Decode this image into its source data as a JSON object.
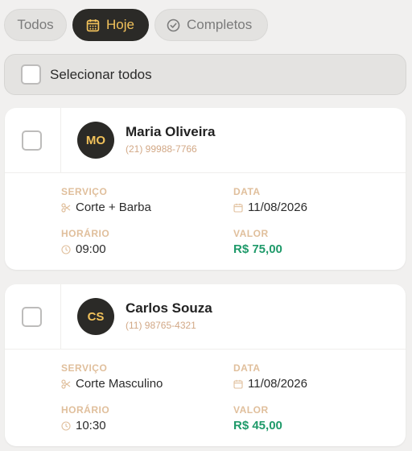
{
  "tabs": [
    {
      "label": "Todos",
      "active": false
    },
    {
      "label": "Hoje",
      "active": true,
      "icon": "calendar-icon"
    },
    {
      "label": "Completos",
      "active": false,
      "icon": "check-circle-icon"
    }
  ],
  "select_all": {
    "label": "Selecionar todos",
    "checked": false
  },
  "field_labels": {
    "service": "SERVIÇO",
    "date": "DATA",
    "time": "HORÁRIO",
    "value": "VALOR"
  },
  "appointments": [
    {
      "initials": "MO",
      "name": "Maria Oliveira",
      "phone": "(21) 99988-7766",
      "service": "Corte + Barba",
      "date": "11/08/2026",
      "time": "09:00",
      "value": "R$ 75,00",
      "checked": false
    },
    {
      "initials": "CS",
      "name": "Carlos Souza",
      "phone": "(11) 98765-4321",
      "service": "Corte Masculino",
      "date": "11/08/2026",
      "time": "10:30",
      "value": "R$ 45,00",
      "checked": false
    }
  ],
  "colors": {
    "accent": "#f2c25b",
    "dark": "#2b2a27",
    "label": "#e0bf9c",
    "price": "#1f9a6a"
  }
}
